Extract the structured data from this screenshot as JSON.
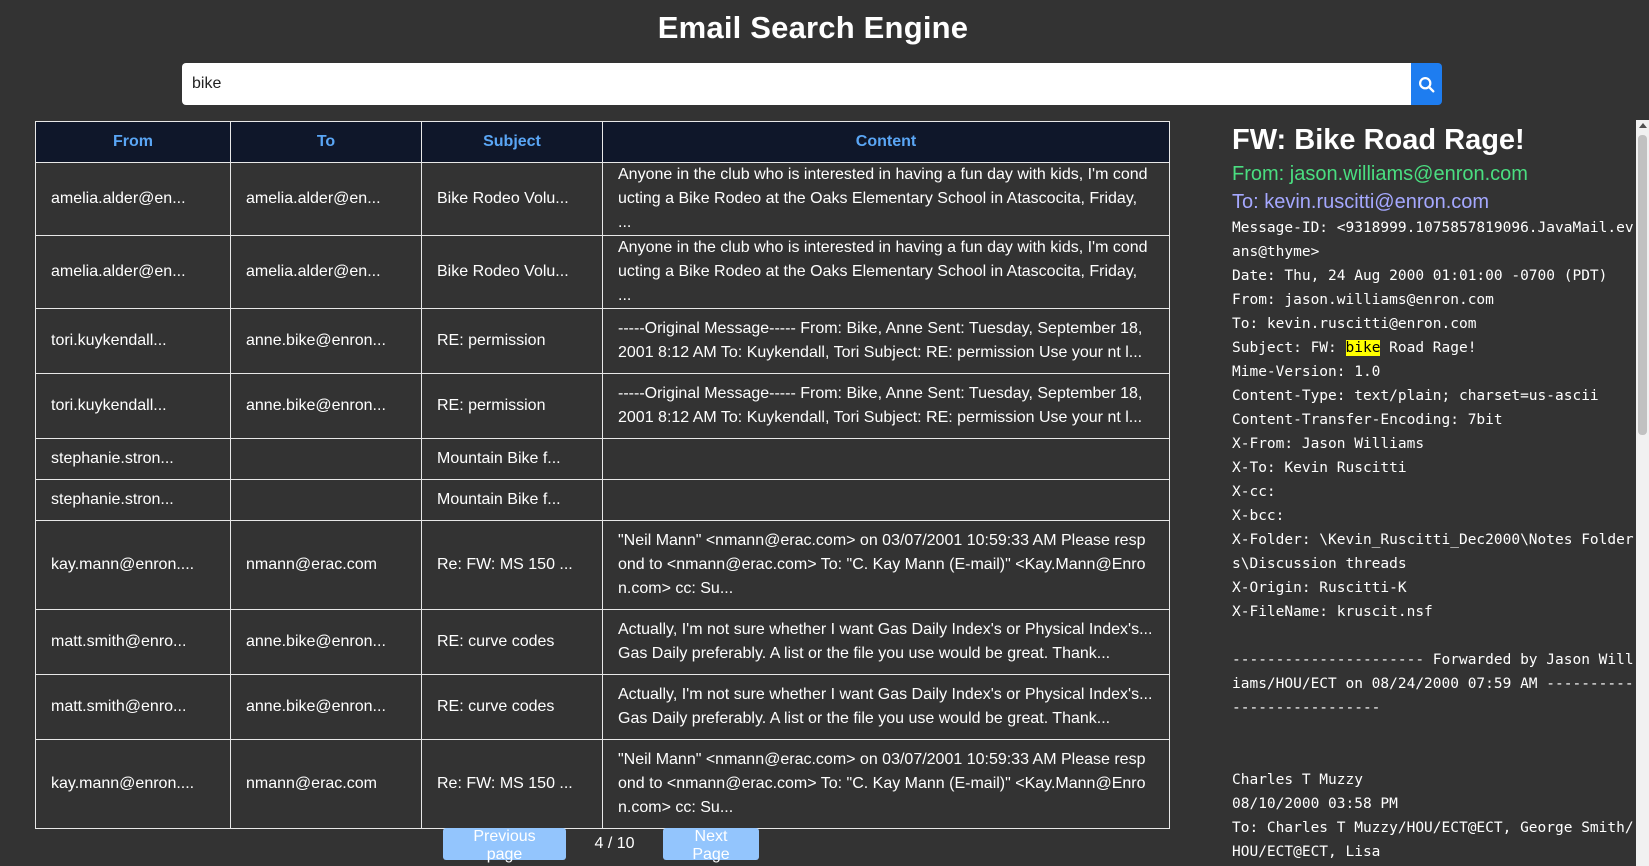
{
  "app": {
    "title": "Email Search Engine"
  },
  "search": {
    "value": "bike",
    "button_icon": "search-icon"
  },
  "table": {
    "columns": [
      "From",
      "To",
      "Subject",
      "Content"
    ],
    "rows": [
      {
        "from": "amelia.alder@en...",
        "to": "amelia.alder@en...",
        "subject": "Bike Rodeo Volu...",
        "content": "Anyone in the club who is interested in having a fun day with kids, I'm conducting a Bike Rodeo at the Oaks Elementary School in Atascocita, Friday, ..."
      },
      {
        "from": "amelia.alder@en...",
        "to": "amelia.alder@en...",
        "subject": "Bike Rodeo Volu...",
        "content": "Anyone in the club who is interested in having a fun day with kids, I'm conducting a Bike Rodeo at the Oaks Elementary School in Atascocita, Friday, ..."
      },
      {
        "from": "tori.kuykendall...",
        "to": "anne.bike@enron...",
        "subject": "RE: permission",
        "content": "-----Original Message----- From: Bike, Anne Sent: Tuesday, September 18, 2001 8:12 AM To: Kuykendall, Tori Subject: RE: permission Use your nt l..."
      },
      {
        "from": "tori.kuykendall...",
        "to": "anne.bike@enron...",
        "subject": "RE: permission",
        "content": "-----Original Message----- From: Bike, Anne Sent: Tuesday, September 18, 2001 8:12 AM To: Kuykendall, Tori Subject: RE: permission Use your nt l..."
      },
      {
        "from": "stephanie.stron...",
        "to": "",
        "subject": "Mountain Bike f...",
        "content": ""
      },
      {
        "from": "stephanie.stron...",
        "to": "",
        "subject": "Mountain Bike f...",
        "content": ""
      },
      {
        "from": "kay.mann@enron....",
        "to": "nmann@erac.com",
        "subject": "Re: FW: MS 150 ...",
        "content": "\"Neil Mann\" <nmann@erac.com> on 03/07/2001 10:59:33 AM Please respond to <nmann@erac.com> To: \"C. Kay Mann (E-mail)\" <Kay.Mann@Enron.com> cc: Su..."
      },
      {
        "from": "matt.smith@enro...",
        "to": "anne.bike@enron...",
        "subject": "RE: curve codes",
        "content": "Actually, I'm not sure whether I want Gas Daily Index's or Physical Index's... Gas Daily preferably. A list or the file you use would be great. Thank..."
      },
      {
        "from": "matt.smith@enro...",
        "to": "anne.bike@enron...",
        "subject": "RE: curve codes",
        "content": "Actually, I'm not sure whether I want Gas Daily Index's or Physical Index's... Gas Daily preferably. A list or the file you use would be great. Thank..."
      },
      {
        "from": "kay.mann@enron....",
        "to": "nmann@erac.com",
        "subject": "Re: FW: MS 150 ...",
        "content": "\"Neil Mann\" <nmann@erac.com> on 03/07/2001 10:59:33 AM Please respond to <nmann@erac.com> To: \"C. Kay Mann (E-mail)\" <Kay.Mann@Enron.com> cc: Su..."
      }
    ]
  },
  "pagination": {
    "prev_label": "Previous page",
    "indicator": "4 / 10",
    "next_label": "Next Page"
  },
  "detail": {
    "subject": "FW: Bike Road Rage!",
    "from": "From: jason.williams@enron.com",
    "to": "To: kevin.ruscitti@enron.com",
    "body_before": "Message-ID: <9318999.1075857819096.JavaMail.evans@thyme>\nDate: Thu, 24 Aug 2000 01:01:00 -0700 (PDT)\nFrom: jason.williams@enron.com\nTo: kevin.ruscitti@enron.com\nSubject: FW: ",
    "highlight": "bike",
    "body_after": " Road Rage!\nMime-Version: 1.0\nContent-Type: text/plain; charset=us-ascii\nContent-Transfer-Encoding: 7bit\nX-From: Jason Williams\nX-To: Kevin Ruscitti\nX-cc: \nX-bcc: \nX-Folder: \\Kevin_Ruscitti_Dec2000\\Notes Folders\\Discussion threads\nX-Origin: Ruscitti-K\nX-FileName: kruscit.nsf\n\n---------------------- Forwarded by Jason Williams/HOU/ECT on 08/24/2000 07:59 AM ---------------------------\n\n\nCharles T Muzzy\n08/10/2000 03:58 PM\nTo: Charles T Muzzy/HOU/ECT@ECT, George Smith/HOU/ECT@ECT, Lisa"
  },
  "colors": {
    "background": "#333333",
    "header_bg": "#0f172a",
    "header_text": "#5aa6f5",
    "search_button": "#1e7df0",
    "pager_button": "#93c5fd",
    "from_text": "#4ade80",
    "to_text": "#a5a8ff",
    "highlight": "#ffff00"
  }
}
